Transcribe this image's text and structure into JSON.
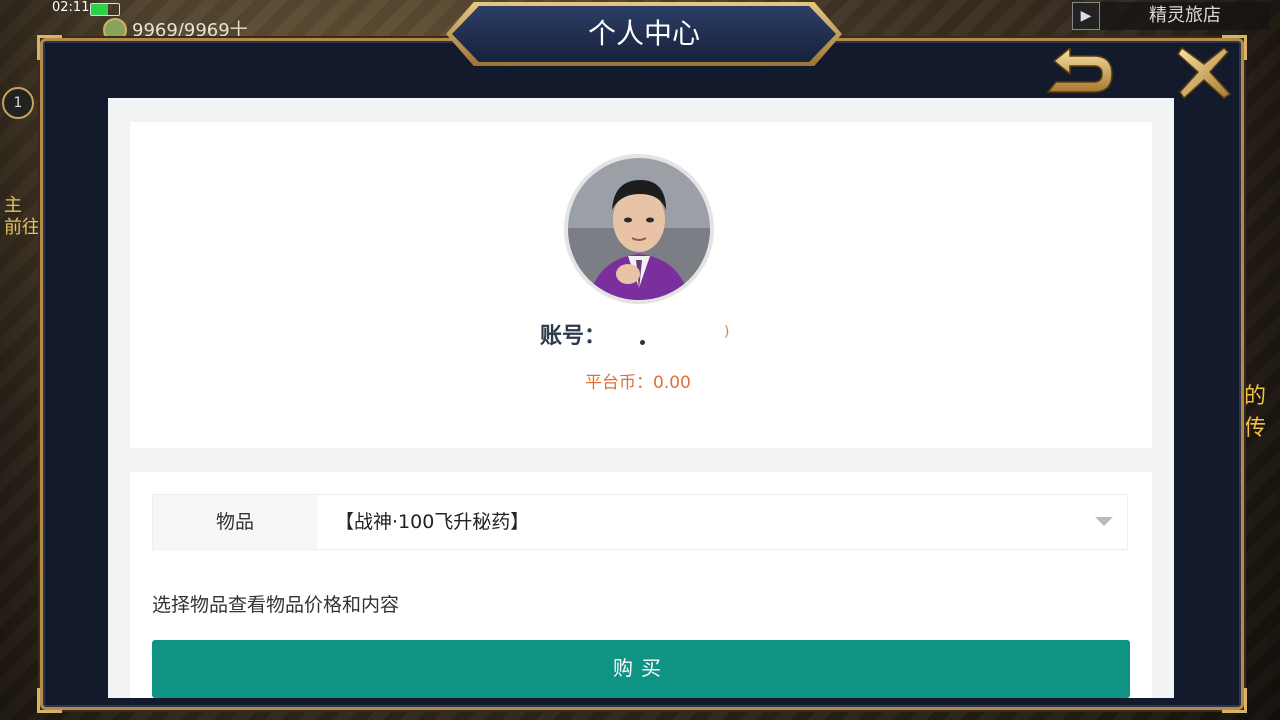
{
  "status_bar": {
    "time": "02:11"
  },
  "hud": {
    "resource": "9969/9969十",
    "level": "1",
    "shop_name": "精灵旅店",
    "side_text": "的传",
    "left_text": "主\n前往"
  },
  "modal": {
    "title": "个人中心",
    "back_icon": "back-arrow-icon",
    "close_icon": "close-x-icon",
    "accent_color": "#b48b4a"
  },
  "profile": {
    "account_label": "账号：",
    "account_value": "",
    "account_suffix": ")",
    "coin_text": "平台币：0.00"
  },
  "purchase": {
    "item_label": "物品",
    "item_selected": "【战神·100飞升秘药】",
    "hint": "选择物品查看物品价格和内容",
    "buy_label": "购买",
    "buy_color": "#0f9483"
  }
}
